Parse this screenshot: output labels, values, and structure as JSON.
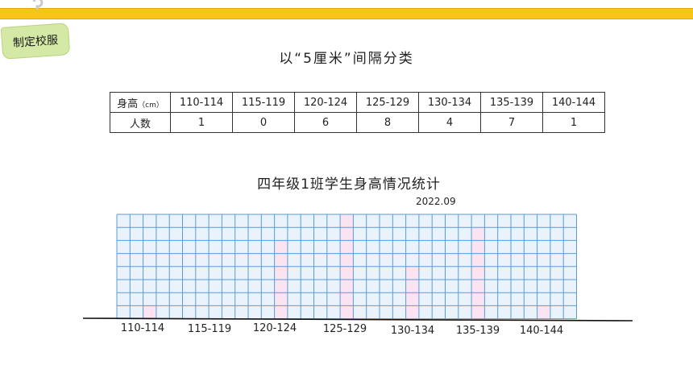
{
  "badge": {
    "label": "制定校服"
  },
  "subtitle": "以“5厘米”间隔分类",
  "table": {
    "row1_label": "身高",
    "row1_unit": "（cm）",
    "row2_label": "人数",
    "ranges": [
      "110-114",
      "115-119",
      "120-124",
      "125-129",
      "130-134",
      "135-139",
      "140-144"
    ],
    "counts": [
      "1",
      "0",
      "6",
      "8",
      "4",
      "7",
      "1"
    ]
  },
  "chart_data": {
    "type": "bar",
    "title": "四年级1班学生身高情况统计",
    "subtitle": "2022.09",
    "categories": [
      "110-114",
      "115-119",
      "120-124",
      "125-129",
      "130-134",
      "135-139",
      "140-144"
    ],
    "values": [
      1,
      0,
      6,
      8,
      4,
      7,
      1
    ],
    "xlabel": "",
    "ylabel": "",
    "ylim": [
      0,
      8
    ],
    "grid": true,
    "colors": {
      "grid": "#5b9bd5",
      "grid_fill": "#eaf3fb",
      "bar": "#fbe3f2",
      "axis": "#111111"
    }
  }
}
